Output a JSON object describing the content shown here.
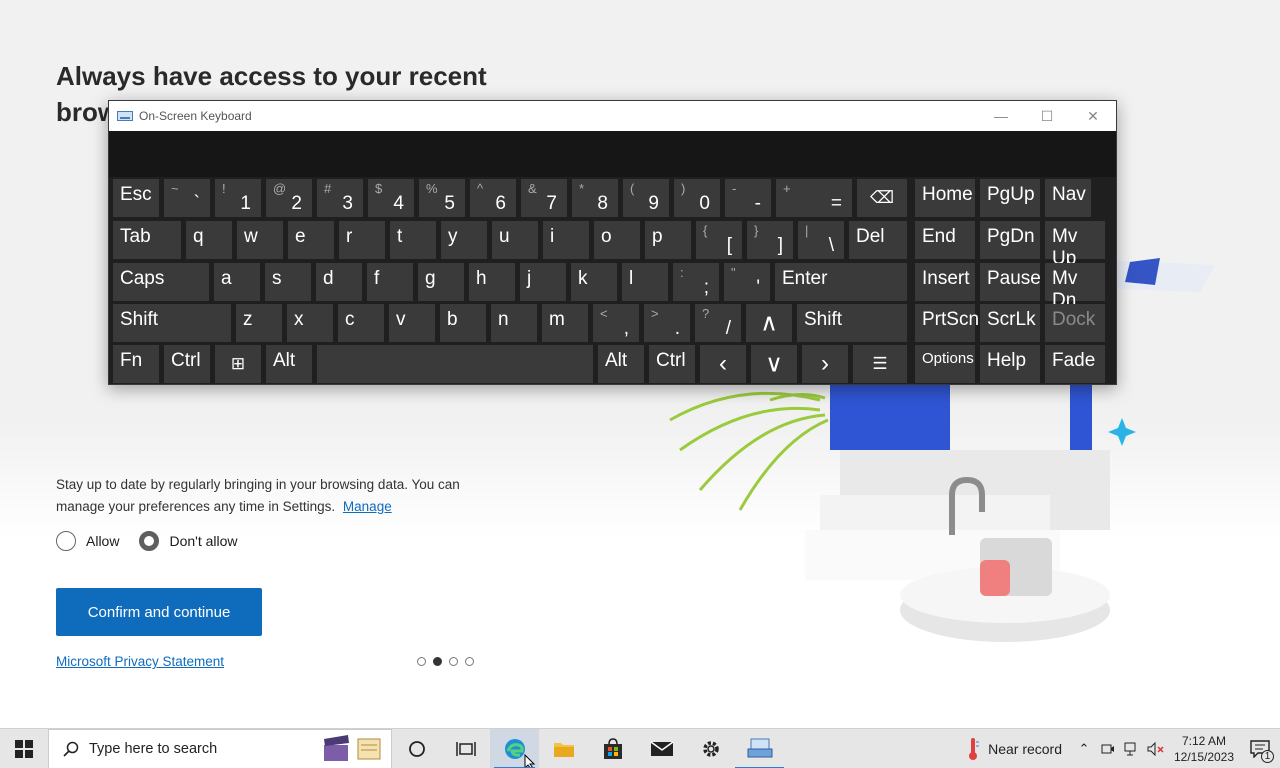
{
  "main": {
    "headline": "Always have access to your recent browsing data",
    "description": "Stay up to date by regularly bringing in your browsing data. You can manage your preferences any time in Settings.",
    "manage_link": "Manage",
    "radio_allow": "Allow",
    "radio_dont_allow": "Don't allow",
    "selected": "Don't allow",
    "confirm_button": "Confirm and continue",
    "privacy_link": "Microsoft Privacy Statement",
    "pager": {
      "total": 4,
      "active_index": 1
    }
  },
  "osk": {
    "title": "On-Screen Keyboard",
    "rows": [
      [
        {
          "main": "Esc"
        },
        {
          "top": "~",
          "bot": "`"
        },
        {
          "top": "!",
          "bot": "1"
        },
        {
          "top": "@",
          "bot": "2"
        },
        {
          "top": "#",
          "bot": "3"
        },
        {
          "top": "$",
          "bot": "4"
        },
        {
          "top": "%",
          "bot": "5"
        },
        {
          "top": "^",
          "bot": "6"
        },
        {
          "top": "&",
          "bot": "7"
        },
        {
          "top": "*",
          "bot": "8"
        },
        {
          "top": "(",
          "bot": "9"
        },
        {
          "top": ")",
          "bot": "0"
        },
        {
          "top": "-",
          "bot": "-"
        },
        {
          "top": "+",
          "bot": "="
        },
        {
          "icon": "backspace-icon"
        },
        {
          "main": "Home"
        },
        {
          "main": "PgUp"
        },
        {
          "main": "Nav"
        }
      ],
      [
        {
          "main": "Tab"
        },
        {
          "main": "q"
        },
        {
          "main": "w"
        },
        {
          "main": "e"
        },
        {
          "main": "r"
        },
        {
          "main": "t"
        },
        {
          "main": "y"
        },
        {
          "main": "u"
        },
        {
          "main": "i"
        },
        {
          "main": "o"
        },
        {
          "main": "p"
        },
        {
          "top": "{",
          "bot": "["
        },
        {
          "top": "}",
          "bot": "]"
        },
        {
          "top": "|",
          "bot": "\\"
        },
        {
          "main": "Del"
        },
        {
          "main": "End"
        },
        {
          "main": "PgDn"
        },
        {
          "main": "Mv Up"
        }
      ],
      [
        {
          "main": "Caps"
        },
        {
          "main": "a"
        },
        {
          "main": "s"
        },
        {
          "main": "d"
        },
        {
          "main": "f"
        },
        {
          "main": "g"
        },
        {
          "main": "h"
        },
        {
          "main": "j"
        },
        {
          "main": "k"
        },
        {
          "main": "l"
        },
        {
          "top": ":",
          "bot": ";"
        },
        {
          "top": "\"",
          "bot": "'"
        },
        {
          "main": "Enter"
        },
        {
          "main": "Insert"
        },
        {
          "main": "Pause"
        },
        {
          "main": "Mv Dn"
        }
      ],
      [
        {
          "main": "Shift"
        },
        {
          "main": "z"
        },
        {
          "main": "x"
        },
        {
          "main": "c"
        },
        {
          "main": "v"
        },
        {
          "main": "b"
        },
        {
          "main": "n"
        },
        {
          "main": "m"
        },
        {
          "top": "<",
          "bot": ","
        },
        {
          "top": ">",
          "bot": "."
        },
        {
          "top": "?",
          "bot": "/"
        },
        {
          "icon": "up-arrow-icon"
        },
        {
          "main": "Shift"
        },
        {
          "main": "PrtScn"
        },
        {
          "main": "ScrLk"
        },
        {
          "main": "Dock"
        }
      ],
      [
        {
          "main": "Fn"
        },
        {
          "main": "Ctrl"
        },
        {
          "icon": "windows-icon"
        },
        {
          "main": "Alt"
        },
        {
          "main": ""
        },
        {
          "main": "Alt"
        },
        {
          "main": "Ctrl"
        },
        {
          "icon": "left-arrow-icon"
        },
        {
          "icon": "down-arrow-icon"
        },
        {
          "icon": "right-arrow-icon"
        },
        {
          "icon": "menu-icon"
        },
        {
          "main": "Options"
        },
        {
          "main": "Help"
        },
        {
          "main": "Fade"
        }
      ]
    ]
  },
  "taskbar": {
    "search_placeholder": "Type here to search",
    "weather_text": "Near record",
    "time": "7:12 AM",
    "date": "12/15/2023",
    "notification_count": "1"
  }
}
